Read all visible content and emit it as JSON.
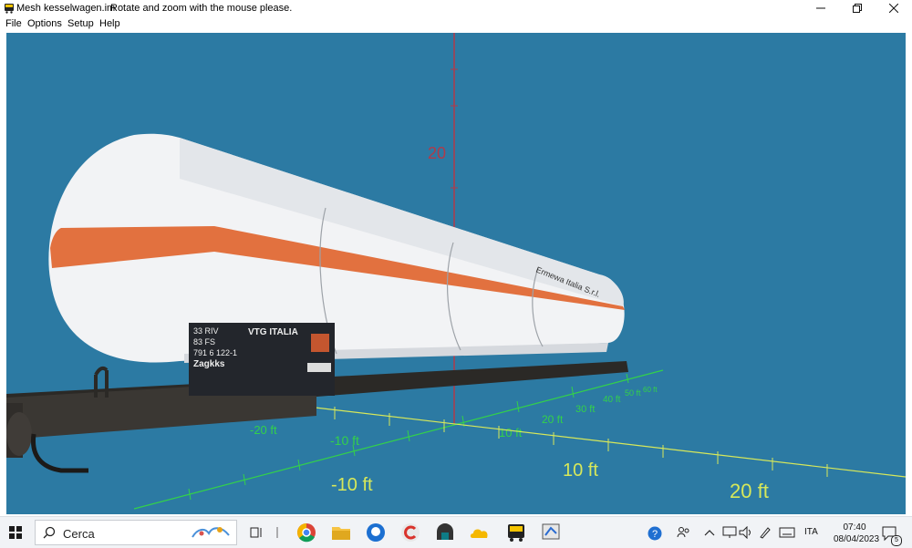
{
  "window": {
    "title": "Mesh kesselwagen.im",
    "hint": "Rotate and zoom with the mouse please."
  },
  "menu": [
    "File",
    "Options",
    "Setup",
    "Help"
  ],
  "viewport": {
    "vertical_axis_label": "20",
    "floor_labels_green": [
      "-20 ft",
      "-10 ft",
      "10 ft",
      "20 ft",
      "30 ft",
      "40 ft",
      "50 ft",
      "60 ft"
    ],
    "floor_labels_yellow": [
      "-10 ft",
      "10 ft",
      "20 ft"
    ]
  },
  "wagon": {
    "plate_lines": [
      "33 RIV",
      "83 FS",
      "791 6 122-1",
      "Zagkks"
    ],
    "plate_brand": "VTG ITALIA",
    "tank_text": "Ermewa Italia S.r.l."
  },
  "taskbar": {
    "search_placeholder": "Cerca",
    "language": "ITA",
    "time": "07:40",
    "date": "08/04/2023",
    "notification_count": "5"
  },
  "colors": {
    "viewport_bg": "#2c7aa3",
    "tank_stripe": "#e2713f",
    "grid_green": "#33d14a",
    "grid_yellow": "#d7e85a",
    "axis_red": "#b03a4a"
  }
}
